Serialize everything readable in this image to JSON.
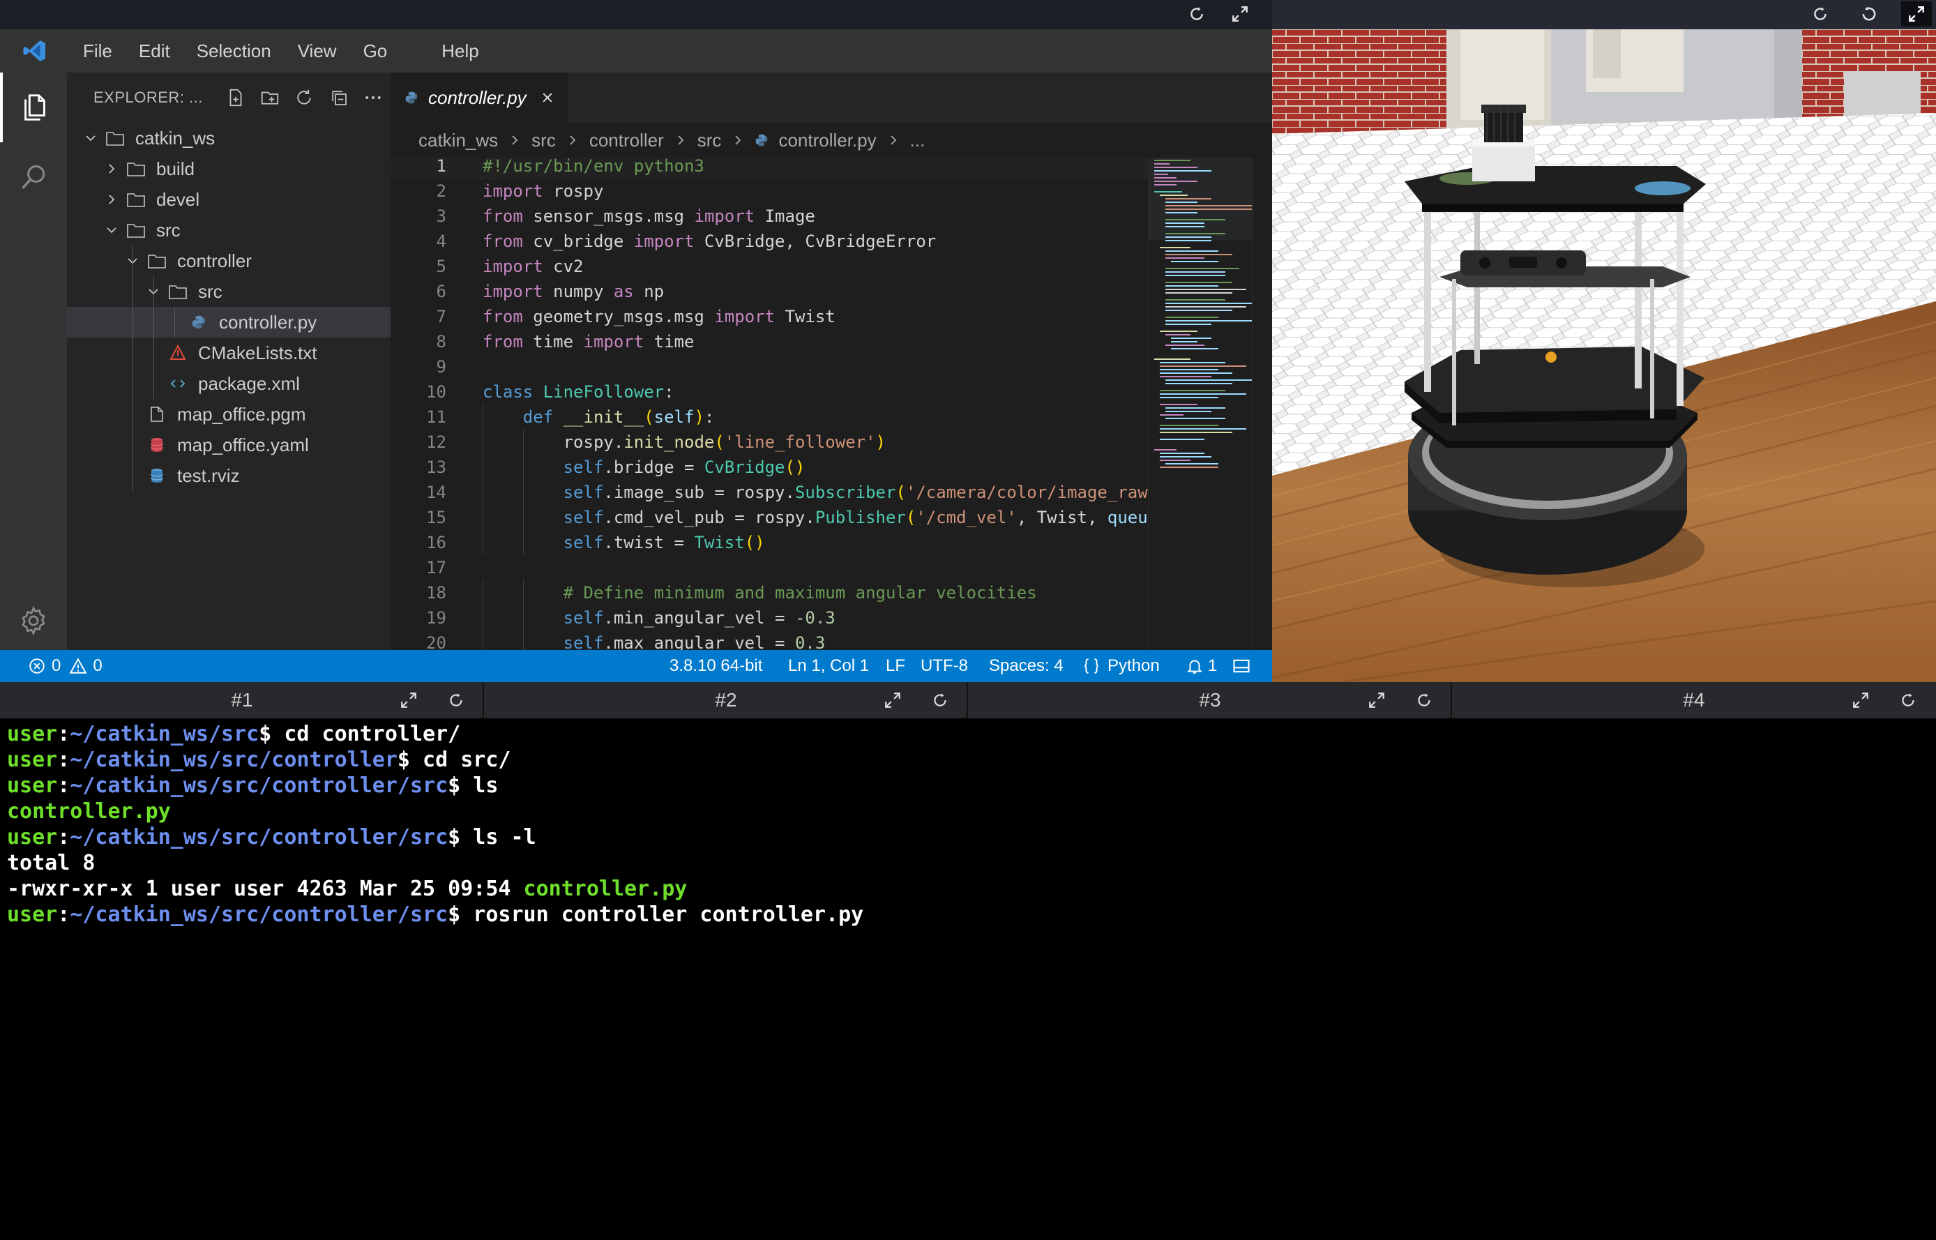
{
  "ide": {
    "menu": [
      "File",
      "Edit",
      "Selection",
      "View",
      "Go",
      "Help"
    ],
    "sidebar": {
      "title": "EXPLORER: ...",
      "tree": [
        {
          "label": "catkin_ws",
          "type": "folder",
          "depth": 0,
          "expanded": true
        },
        {
          "label": "build",
          "type": "folder",
          "depth": 1,
          "expanded": false
        },
        {
          "label": "devel",
          "type": "folder",
          "depth": 1,
          "expanded": false
        },
        {
          "label": "src",
          "type": "folder",
          "depth": 1,
          "expanded": true
        },
        {
          "label": "controller",
          "type": "folder",
          "depth": 2,
          "expanded": true
        },
        {
          "label": "src",
          "type": "folder",
          "depth": 3,
          "expanded": true
        },
        {
          "label": "controller.py",
          "type": "python",
          "depth": 4,
          "selected": true
        },
        {
          "label": "CMakeLists.txt",
          "type": "cmake",
          "depth": 3
        },
        {
          "label": "package.xml",
          "type": "xml",
          "depth": 3
        },
        {
          "label": "map_office.pgm",
          "type": "file",
          "depth": 2
        },
        {
          "label": "map_office.yaml",
          "type": "yaml",
          "depth": 2
        },
        {
          "label": "test.rviz",
          "type": "rviz",
          "depth": 2
        }
      ]
    },
    "tab": {
      "label": "controller.py"
    },
    "breadcrumb": [
      "catkin_ws",
      "src",
      "controller",
      "src",
      "controller.py",
      "..."
    ],
    "code_lines": [
      {
        "n": "1",
        "tokens": [
          [
            "com",
            "#!/usr/bin/env python3"
          ]
        ]
      },
      {
        "n": "2",
        "tokens": [
          [
            "kw",
            "import"
          ],
          [
            "plain",
            " rospy"
          ]
        ]
      },
      {
        "n": "3",
        "tokens": [
          [
            "kw",
            "from"
          ],
          [
            "plain",
            " sensor_msgs.msg "
          ],
          [
            "kw",
            "import"
          ],
          [
            "plain",
            " Image"
          ]
        ]
      },
      {
        "n": "4",
        "tokens": [
          [
            "kw",
            "from"
          ],
          [
            "plain",
            " cv_bridge "
          ],
          [
            "kw",
            "import"
          ],
          [
            "plain",
            " CvBridge, CvBridgeError"
          ]
        ]
      },
      {
        "n": "5",
        "tokens": [
          [
            "kw",
            "import"
          ],
          [
            "plain",
            " cv2"
          ]
        ]
      },
      {
        "n": "6",
        "tokens": [
          [
            "kw",
            "import"
          ],
          [
            "plain",
            " numpy "
          ],
          [
            "kw",
            "as"
          ],
          [
            "plain",
            " np"
          ]
        ]
      },
      {
        "n": "7",
        "tokens": [
          [
            "kw",
            "from"
          ],
          [
            "plain",
            " geometry_msgs.msg "
          ],
          [
            "kw",
            "import"
          ],
          [
            "plain",
            " Twist"
          ]
        ]
      },
      {
        "n": "8",
        "tokens": [
          [
            "kw",
            "from"
          ],
          [
            "plain",
            " time "
          ],
          [
            "kw",
            "import"
          ],
          [
            "plain",
            " time"
          ]
        ]
      },
      {
        "n": "9",
        "tokens": []
      },
      {
        "n": "10",
        "tokens": [
          [
            "def",
            "class"
          ],
          [
            "plain",
            " "
          ],
          [
            "cls",
            "LineFollower"
          ],
          [
            "plain",
            ":"
          ]
        ]
      },
      {
        "n": "11",
        "tokens": [
          [
            "plain",
            "    "
          ],
          [
            "def",
            "def"
          ],
          [
            "plain",
            " "
          ],
          [
            "fn",
            "__init__"
          ],
          [
            "par",
            "("
          ],
          [
            "param",
            "self"
          ],
          [
            "par",
            ")"
          ],
          [
            "plain",
            ":"
          ]
        ]
      },
      {
        "n": "12",
        "tokens": [
          [
            "plain",
            "        rospy."
          ],
          [
            "fn",
            "init_node"
          ],
          [
            "par",
            "("
          ],
          [
            "str",
            "'line_follower'"
          ],
          [
            "par",
            ")"
          ]
        ]
      },
      {
        "n": "13",
        "tokens": [
          [
            "plain",
            "        "
          ],
          [
            "self",
            "self"
          ],
          [
            "plain",
            ".bridge = "
          ],
          [
            "cls",
            "CvBridge"
          ],
          [
            "par",
            "()"
          ]
        ]
      },
      {
        "n": "14",
        "tokens": [
          [
            "plain",
            "        "
          ],
          [
            "self",
            "self"
          ],
          [
            "plain",
            ".image_sub = rospy."
          ],
          [
            "cls",
            "Subscriber"
          ],
          [
            "par",
            "("
          ],
          [
            "str",
            "'/camera/color/image_raw'"
          ]
        ]
      },
      {
        "n": "15",
        "tokens": [
          [
            "plain",
            "        "
          ],
          [
            "self",
            "self"
          ],
          [
            "plain",
            ".cmd_vel_pub = rospy."
          ],
          [
            "cls",
            "Publisher"
          ],
          [
            "par",
            "("
          ],
          [
            "str",
            "'/cmd_vel'"
          ],
          [
            "plain",
            ", Twist, "
          ],
          [
            "param",
            "queue_size"
          ]
        ]
      },
      {
        "n": "16",
        "tokens": [
          [
            "plain",
            "        "
          ],
          [
            "self",
            "self"
          ],
          [
            "plain",
            ".twist = "
          ],
          [
            "cls",
            "Twist"
          ],
          [
            "par",
            "()"
          ]
        ]
      },
      {
        "n": "17",
        "tokens": []
      },
      {
        "n": "18",
        "tokens": [
          [
            "plain",
            "        "
          ],
          [
            "com",
            "# Define minimum and maximum angular velocities"
          ]
        ]
      },
      {
        "n": "19",
        "tokens": [
          [
            "plain",
            "        "
          ],
          [
            "self",
            "self"
          ],
          [
            "plain",
            ".min_angular_vel = "
          ],
          [
            "num",
            "-0.3"
          ]
        ]
      },
      {
        "n": "20",
        "tokens": [
          [
            "plain",
            "        "
          ],
          [
            "self",
            "self"
          ],
          [
            "plain",
            ".max_angular_vel = "
          ],
          [
            "num",
            "0.3"
          ]
        ]
      }
    ],
    "status": {
      "errors": "0",
      "warnings": "0",
      "interpreter": "3.8.10 64-bit",
      "cursor": "Ln 1, Col 1",
      "eol": "LF",
      "encoding": "UTF-8",
      "indent": "Spaces: 4",
      "language": "Python",
      "notifications": "1"
    }
  },
  "terminal": {
    "tabs": [
      "#1",
      "#2",
      "#3",
      "#4"
    ],
    "lines": [
      [
        [
          "user",
          "user"
        ],
        [
          "plain",
          ":"
        ],
        [
          "path",
          "~/catkin_ws/src"
        ],
        [
          "plain",
          "$ cd controller/"
        ]
      ],
      [
        [
          "user",
          "user"
        ],
        [
          "plain",
          ":"
        ],
        [
          "path",
          "~/catkin_ws/src/controller"
        ],
        [
          "plain",
          "$ cd src/"
        ]
      ],
      [
        [
          "user",
          "user"
        ],
        [
          "plain",
          ":"
        ],
        [
          "path",
          "~/catkin_ws/src/controller/src"
        ],
        [
          "plain",
          "$ ls"
        ]
      ],
      [
        [
          "exec",
          "controller.py"
        ]
      ],
      [
        [
          "user",
          "user"
        ],
        [
          "plain",
          ":"
        ],
        [
          "path",
          "~/catkin_ws/src/controller/src"
        ],
        [
          "plain",
          "$ ls -l"
        ]
      ],
      [
        [
          "plain",
          "total 8"
        ]
      ],
      [
        [
          "plain",
          "-rwxr-xr-x 1 user user 4263 Mar 25 09:54 "
        ],
        [
          "exec",
          "controller.py"
        ]
      ],
      [
        [
          "user",
          "user"
        ],
        [
          "plain",
          ":"
        ],
        [
          "path",
          "~/catkin_ws/src/controller/src"
        ],
        [
          "plain",
          "$ rosrun controller controller.py"
        ]
      ]
    ]
  },
  "colors": {
    "status_bar": "#007acc",
    "editor_bg": "#1e1e1e",
    "sidebar_bg": "#252526",
    "terminal_user": "#6ee02a",
    "terminal_path": "#6d8ff0"
  },
  "icons": [
    "vscode-logo-icon",
    "files-icon",
    "search-icon",
    "settings-gear-icon",
    "new-file-icon",
    "new-folder-icon",
    "refresh-icon",
    "collapse-all-icon",
    "more-icon",
    "close-icon",
    "python-file-icon",
    "folder-icon",
    "chevron-right-icon",
    "chevron-down-icon",
    "error-icon",
    "warning-icon",
    "bell-icon",
    "layout-icon",
    "reload-icon",
    "expand-icon"
  ]
}
